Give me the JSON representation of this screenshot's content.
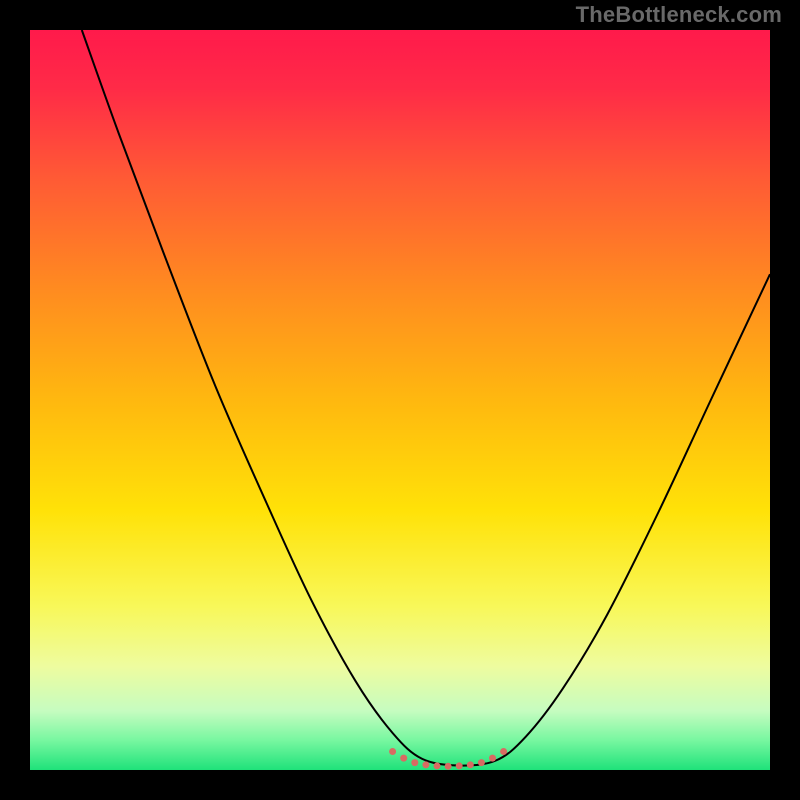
{
  "watermark": "TheBottleneck.com",
  "chart_data": {
    "type": "line",
    "title": "",
    "xlabel": "",
    "ylabel": "",
    "xlim": [
      0,
      100
    ],
    "ylim": [
      0,
      100
    ],
    "grid": false,
    "legend": false,
    "gradient_stops": [
      {
        "offset": 0.0,
        "color": "#ff1a4b"
      },
      {
        "offset": 0.08,
        "color": "#ff2b47"
      },
      {
        "offset": 0.2,
        "color": "#ff5a35"
      },
      {
        "offset": 0.35,
        "color": "#ff8b20"
      },
      {
        "offset": 0.5,
        "color": "#ffb80f"
      },
      {
        "offset": 0.65,
        "color": "#ffe208"
      },
      {
        "offset": 0.78,
        "color": "#f8f85a"
      },
      {
        "offset": 0.86,
        "color": "#eefc9f"
      },
      {
        "offset": 0.92,
        "color": "#c6fcc0"
      },
      {
        "offset": 0.96,
        "color": "#77f7a0"
      },
      {
        "offset": 1.0,
        "color": "#1ee27a"
      }
    ],
    "series": [
      {
        "name": "bottleneck-curve",
        "stroke": "#000000",
        "stroke_width": 2,
        "points": [
          {
            "x": 7.0,
            "y": 100.0
          },
          {
            "x": 12.0,
            "y": 86.0
          },
          {
            "x": 18.0,
            "y": 70.0
          },
          {
            "x": 25.0,
            "y": 52.0
          },
          {
            "x": 32.0,
            "y": 36.0
          },
          {
            "x": 38.0,
            "y": 23.0
          },
          {
            "x": 44.0,
            "y": 12.0
          },
          {
            "x": 49.0,
            "y": 5.0
          },
          {
            "x": 53.0,
            "y": 1.5
          },
          {
            "x": 58.0,
            "y": 0.6
          },
          {
            "x": 63.0,
            "y": 1.3
          },
          {
            "x": 67.0,
            "y": 4.5
          },
          {
            "x": 72.0,
            "y": 11.0
          },
          {
            "x": 78.0,
            "y": 21.0
          },
          {
            "x": 85.0,
            "y": 35.0
          },
          {
            "x": 92.0,
            "y": 50.0
          },
          {
            "x": 100.0,
            "y": 67.0
          }
        ]
      },
      {
        "name": "sweet-spot-marker",
        "type": "scatter",
        "stroke": "#d86b62",
        "stroke_width": 7,
        "points": [
          {
            "x": 49.0,
            "y": 2.5
          },
          {
            "x": 50.5,
            "y": 1.6
          },
          {
            "x": 52.0,
            "y": 1.0
          },
          {
            "x": 53.5,
            "y": 0.7
          },
          {
            "x": 55.0,
            "y": 0.55
          },
          {
            "x": 56.5,
            "y": 0.5
          },
          {
            "x": 58.0,
            "y": 0.55
          },
          {
            "x": 59.5,
            "y": 0.7
          },
          {
            "x": 61.0,
            "y": 1.0
          },
          {
            "x": 62.5,
            "y": 1.6
          },
          {
            "x": 64.0,
            "y": 2.5
          }
        ]
      }
    ]
  }
}
